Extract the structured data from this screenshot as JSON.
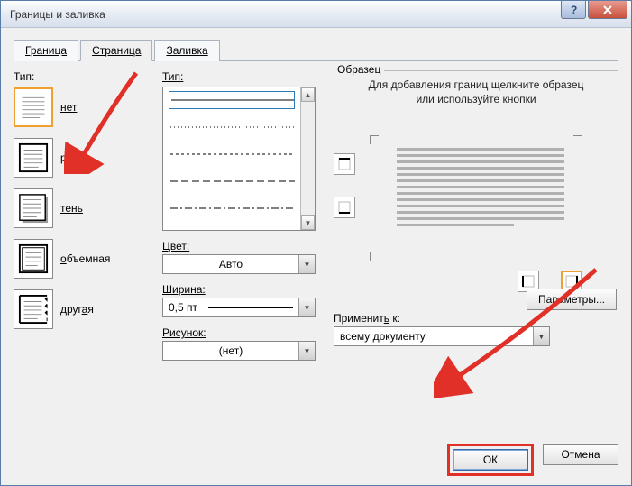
{
  "title": "Границы и заливка",
  "tabs": {
    "borders": "Граница",
    "page": "Страница",
    "shading": "Заливка"
  },
  "left": {
    "label": "Тип:",
    "items": [
      {
        "label": "нет"
      },
      {
        "label": "рамка"
      },
      {
        "label": "тень"
      },
      {
        "label": "объемная"
      },
      {
        "label": "другая"
      }
    ]
  },
  "mid": {
    "style_label": "Тип:",
    "color_label": "Цвет:",
    "color_value": "Авто",
    "width_label": "Ширина:",
    "width_value": "0,5 пт",
    "art_label": "Рисунок:",
    "art_value": "(нет)"
  },
  "right": {
    "preview_label": "Образец",
    "hint": "Для добавления границ щелкните образец или используйте кнопки",
    "apply_label": "Применить к:",
    "apply_value": "всему документу",
    "options": "Параметры..."
  },
  "buttons": {
    "ok": "ОК",
    "cancel": "Отмена"
  }
}
